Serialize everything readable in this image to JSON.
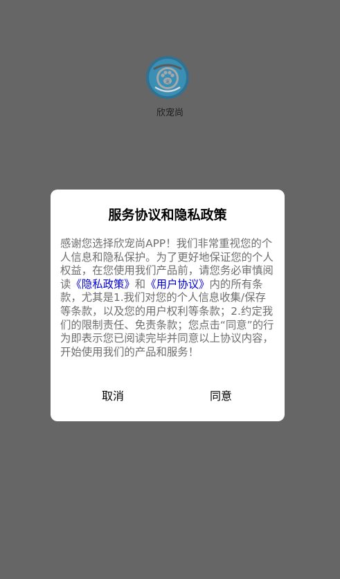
{
  "app": {
    "name": "欣宠尚",
    "logo_badge": "宠"
  },
  "dialog": {
    "title": "服务协议和隐私政策",
    "body_part1": "感谢您选择欣宠尚APP！我们非常重视您的个人信息和隐私保护。为了更好地保证您的个人权益，在您使用我们产品前，请您务必审慎阅读",
    "privacy_link": "《隐私政策》",
    "and_text": "和",
    "user_link": "《用户协议》",
    "body_part2": "内的所有条款，尤其是1.我们对您的个人信息收集/保存等条款，以及您的用户权利等条款；2.约定我们的限制责任、免责条款；您点击“同意”的行为即表示您已阅读完毕并同意以上协议内容，开始使用我们的产品和服务！",
    "cancel_label": "取消",
    "agree_label": "同意"
  },
  "colors": {
    "overlay": "#666666",
    "link": "#0000dd",
    "logo_bg": "#3a8fb5"
  }
}
